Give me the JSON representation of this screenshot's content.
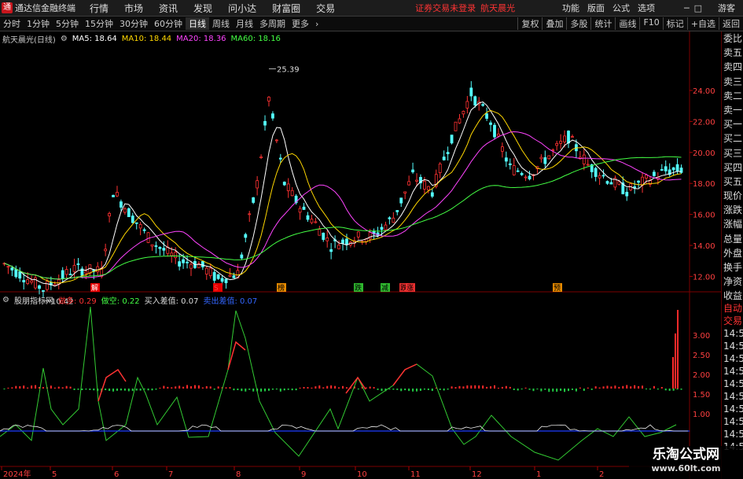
{
  "app": {
    "title": "通达信金融终端",
    "menus": [
      "行情",
      "市场",
      "资讯",
      "发现",
      "问小达",
      "财富圈",
      "交易"
    ],
    "status": "证券交易未登录",
    "stock_name": "航天晨光",
    "right_menus": [
      "功能",
      "版面",
      "公式",
      "选项"
    ],
    "guest": "游客"
  },
  "toolbar": {
    "periods": [
      "分时",
      "1分钟",
      "5分钟",
      "15分钟",
      "30分钟",
      "60分钟",
      "日线",
      "周线",
      "月线",
      "多周期",
      "更多"
    ],
    "active_period": "日线",
    "tools": [
      "复权",
      "叠加",
      "多股",
      "统计",
      "画线",
      "F10",
      "标记",
      "+自选",
      "返回"
    ]
  },
  "info": {
    "title": "航天晨光(日线)",
    "ma5": "MA5: 18.64",
    "ma10": "MA10: 18.44",
    "ma20": "MA20: 18.36",
    "ma60": "MA60: 18.16"
  },
  "price_chart": {
    "y_ticks": [
      "24.00",
      "22.00",
      "20.00",
      "18.00",
      "16.00",
      "14.00",
      "12.00"
    ],
    "high_label": "25.39",
    "low_label": "10.42",
    "event_markers": [
      "解",
      "S",
      "榜",
      "跌",
      "减",
      "跌",
      "涨",
      "预"
    ],
    "colors": {
      "up": "#ff3232",
      "down": "#54ffff",
      "ma5": "#ffffff",
      "ma10": "#ffd700",
      "ma20": "#ff44ff",
      "ma60": "#44ff44"
    }
  },
  "indicator": {
    "name": "股朋指标网",
    "v1": "做多: 0.29",
    "v2": "做空: 0.22",
    "v3": "买入差值: 0.07",
    "v4": "卖出差值: 0.07",
    "y_ticks": [
      "3.00",
      "2.50",
      "2.00",
      "1.50",
      "1.00"
    ]
  },
  "x_axis": [
    "2024年",
    "5",
    "6",
    "7",
    "8",
    "9",
    "10",
    "11",
    "12",
    "1",
    "2"
  ],
  "right_panel": {
    "items": [
      "委比",
      "卖五",
      "卖四",
      "卖三",
      "卖二",
      "卖一",
      "买一",
      "买二",
      "买三",
      "买四",
      "买五",
      "现价",
      "涨跌",
      "涨幅",
      "总量",
      "外盘",
      "换手",
      "净资",
      "收益"
    ],
    "bottom_items": [
      "自动",
      "交易",
      "14:56",
      "14:56",
      "14:56",
      "14:56",
      "14:56",
      "14:56",
      "14:56",
      "14:56",
      "14:56",
      "14:56"
    ]
  },
  "watermark": {
    "line1": "乐淘公式网",
    "line2": "www.60lt.com"
  }
}
